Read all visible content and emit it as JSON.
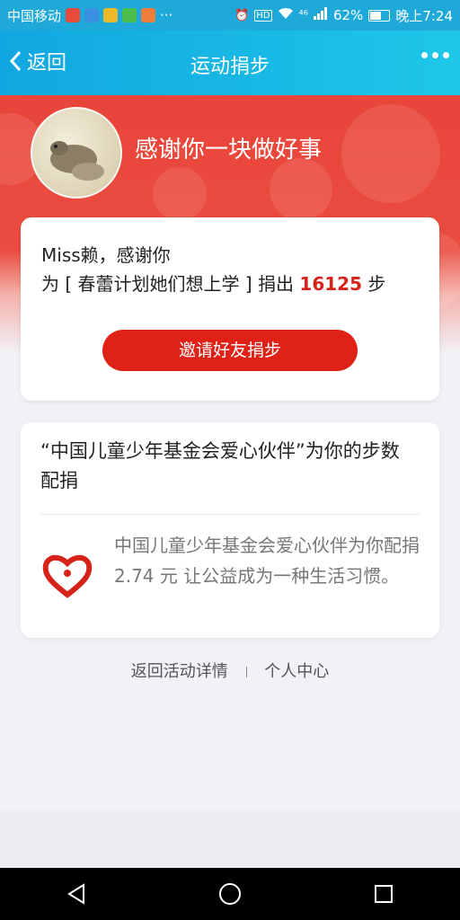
{
  "status_bar": {
    "carrier": "中国移动",
    "dots": "···",
    "network": "⁴⁶",
    "battery_text": "62%",
    "time": "晚上7:24"
  },
  "nav": {
    "back_label": "返回",
    "title": "运动捐步",
    "more_icon": "more-dots-icon"
  },
  "hero": {
    "thanks_text": "感谢你一块做好事"
  },
  "donation": {
    "greeting": "Miss赖，感谢你",
    "prefix": "为 [ 春蕾计划她们想上学 ] 捐出 ",
    "steps": "16125",
    "suffix": " 步",
    "invite_label": "邀请好友捐步"
  },
  "partner": {
    "heading": "“中国儿童少年基金会爱心伙伴”为你的步数配捐",
    "body": "中国儿童少年基金会爱心伙伴为你配捐 2.74 元 让公益成为一种生活习惯。"
  },
  "footer_links": {
    "back_to_activity": "返回活动详情",
    "personal_center": "个人中心"
  },
  "colors": {
    "accent_blue": "#1fa9d9",
    "hero_red": "#e9453a",
    "button_red": "#df2117"
  }
}
